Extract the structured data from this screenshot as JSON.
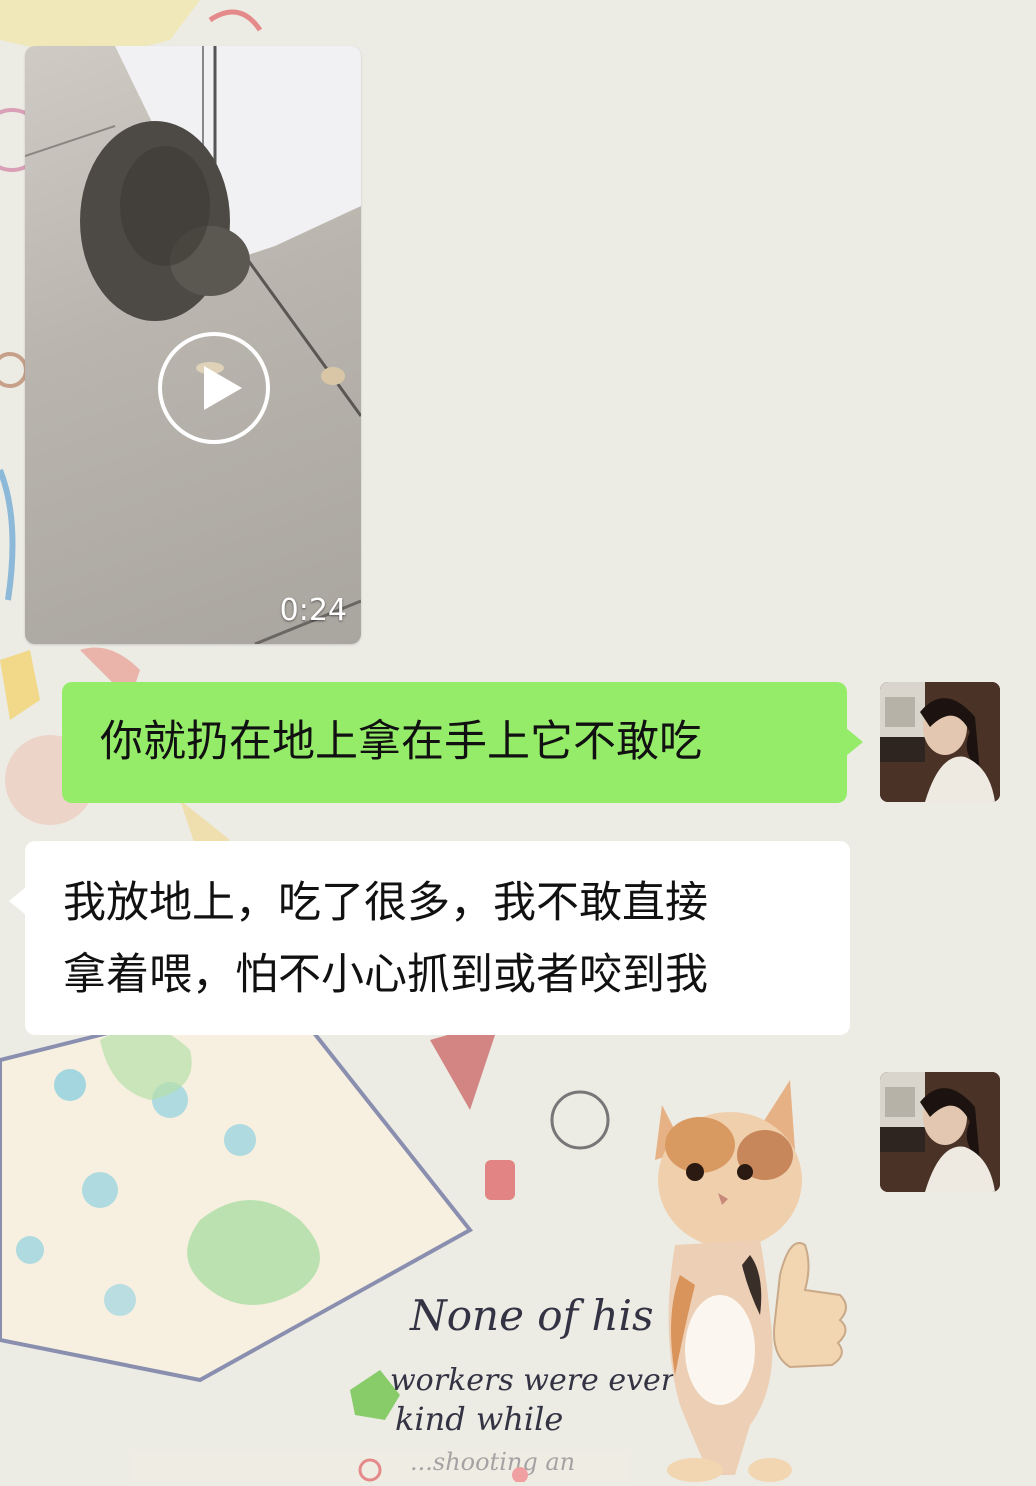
{
  "chat": {
    "video_message": {
      "duration": "0:24",
      "icon": "play-icon"
    },
    "outgoing_message": {
      "text": "你就扔在地上拿在手上它不敢吃"
    },
    "incoming_message": {
      "lines": [
        "我放地上，吃了很多，我不敢直接",
        "拿着喂，怕不小心抓到或者咬到我"
      ]
    },
    "sticker": {
      "description_icon": "cat-thumbs-up-sticker",
      "handwritten_text": [
        "None of his",
        "workers were ever",
        "kind while",
        "...shooting an"
      ]
    }
  },
  "colors": {
    "outgoing_bubble": "#95ec69",
    "incoming_bubble": "#ffffff",
    "background": "#ecebe4"
  }
}
